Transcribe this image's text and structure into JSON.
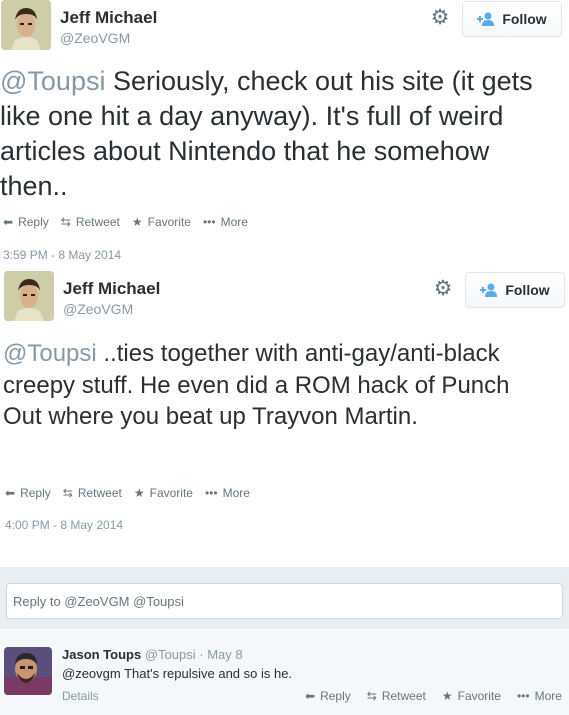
{
  "tweets": [
    {
      "name": "Jeff Michael",
      "handle": "@ZeoVGM",
      "follow_label": "Follow",
      "text_mention": "@Toupsi",
      "text_body": " Seriously, check out his site (it gets like one hit a day anyway). It's full of weird articles about Nintendo that he somehow then..",
      "actions": {
        "reply": "Reply",
        "retweet": "Retweet",
        "favorite": "Favorite",
        "more": "More"
      },
      "timestamp": "3:59 PM - 8 May 2014"
    },
    {
      "name": "Jeff Michael",
      "handle": "@ZeoVGM",
      "follow_label": "Follow",
      "text_mention": "@Toupsi",
      "text_body": " ..ties together with anti-gay/anti-black creepy stuff. He even did a ROM hack of Punch Out where you beat up Trayvon Martin.",
      "actions": {
        "reply": "Reply",
        "retweet": "Retweet",
        "favorite": "Favorite",
        "more": "More"
      },
      "timestamp": "4:00 PM - 8 May 2014"
    }
  ],
  "reply_box": {
    "placeholder": "Reply to @ZeoVGM @Toupsi"
  },
  "reply": {
    "name": "Jason Toups",
    "handle": "@Toupsi",
    "separator": "·",
    "date": "May 8",
    "text": "@zeovgm That's repulsive and so is he.",
    "details": "Details",
    "actions": {
      "reply": "Reply",
      "retweet": "Retweet",
      "favorite": "Favorite",
      "more": "More"
    }
  },
  "icons": {
    "gear": "gear-icon",
    "follow": "add-user-icon",
    "reply": "reply-arrow-icon",
    "retweet": "retweet-icon",
    "favorite": "star-icon",
    "more": "ellipsis-icon"
  },
  "colors": {
    "accent": "#55acee",
    "muted": "#8899a6",
    "text": "#292f33"
  }
}
